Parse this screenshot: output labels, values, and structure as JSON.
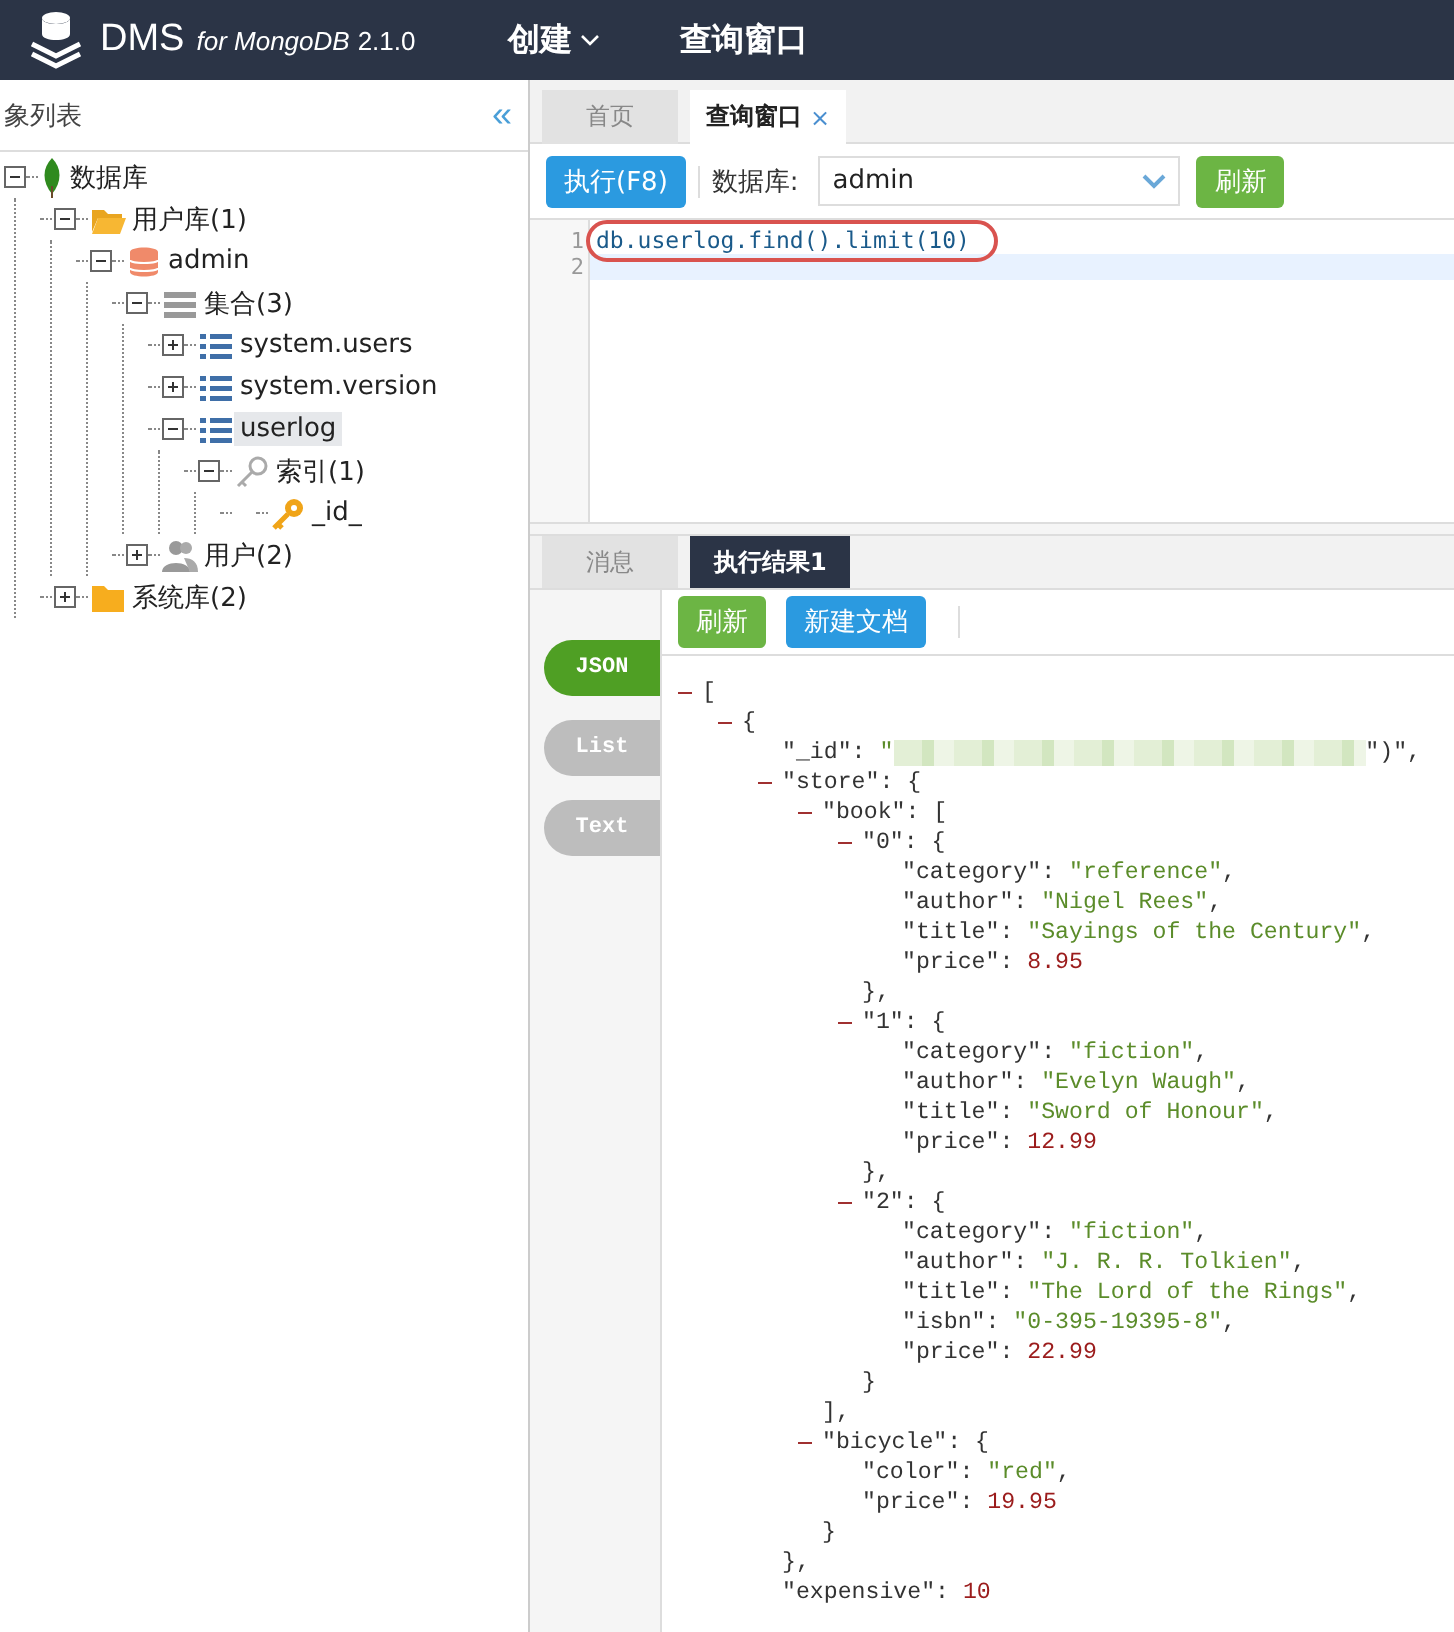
{
  "header": {
    "brand": "DMS",
    "brand_suffix": "for MongoDB",
    "version": "2.1.0",
    "nav": [
      {
        "label": "创建",
        "dropdown": true
      },
      {
        "label": "查询窗口",
        "dropdown": false
      }
    ]
  },
  "sidebar": {
    "title": "象列表",
    "collapse": "«",
    "tree": [
      {
        "label": "数据库",
        "kind": "leaf",
        "expanded": true,
        "selected": false,
        "children": [
          {
            "label": "用户库(1)",
            "kind": "folder-open",
            "expanded": true,
            "selected": false,
            "children": [
              {
                "label": "admin",
                "kind": "database",
                "expanded": true,
                "selected": false,
                "children": [
                  {
                    "label": "集合(3)",
                    "kind": "stack",
                    "expanded": true,
                    "selected": false,
                    "children": [
                      {
                        "label": "system.users",
                        "kind": "list",
                        "expanded": false,
                        "selected": false
                      },
                      {
                        "label": "system.version",
                        "kind": "list",
                        "expanded": false,
                        "selected": false
                      },
                      {
                        "label": "userlog",
                        "kind": "list",
                        "expanded": true,
                        "selected": true,
                        "children": [
                          {
                            "label": "索引(1)",
                            "kind": "key-outline",
                            "expanded": true,
                            "selected": false,
                            "children": [
                              {
                                "label": "_id_",
                                "kind": "key",
                                "selected": false
                              }
                            ]
                          }
                        ]
                      }
                    ]
                  },
                  {
                    "label": "用户(2)",
                    "kind": "users",
                    "expanded": false,
                    "selected": false
                  }
                ]
              }
            ]
          },
          {
            "label": "系统库(2)",
            "kind": "folder",
            "expanded": false,
            "selected": false
          }
        ]
      }
    ]
  },
  "tabs": [
    {
      "label": "首页",
      "selected": false,
      "closable": false
    },
    {
      "label": "查询窗口",
      "selected": true,
      "closable": true,
      "close": "×"
    }
  ],
  "toolbar": {
    "run": "执行(F8)",
    "db_label": "数据库:",
    "db_value": "admin",
    "refresh": "刷新"
  },
  "editor": {
    "lines": [
      {
        "number": "1",
        "code": "db.userlog.find().limit(10)",
        "current": false,
        "annotated": true
      },
      {
        "number": "2",
        "current": true
      }
    ]
  },
  "result_tabs": [
    {
      "label": "消息",
      "selected": false
    },
    {
      "label": "执行结果1",
      "selected": true
    }
  ],
  "view_modes": [
    {
      "label": "JSON",
      "selected": true
    },
    {
      "label": "List",
      "selected": false
    },
    {
      "label": "Text",
      "selected": false
    }
  ],
  "result_toolbar": {
    "buttons": [
      {
        "label": "刷新",
        "kind": "green"
      },
      {
        "label": "新建文档",
        "kind": "blue"
      }
    ]
  },
  "result": {
    "kind": "node",
    "label": "[",
    "expanded": true,
    "children": [
      {
        "kind": "node",
        "label": "{",
        "expanded": true,
        "children": [
          {
            "kind": "redacted",
            "key": "\"_id\": ",
            "prefix": "\"",
            "suffix": "\")\","
          },
          {
            "kind": "node",
            "label": "\"store\": {",
            "expanded": true,
            "close": "},",
            "children": [
              {
                "kind": "node",
                "label": "\"book\": [",
                "expanded": true,
                "close": "],",
                "children": [
                  {
                    "kind": "node",
                    "label": "\"0\": {",
                    "expanded": true,
                    "close": "},",
                    "children": [
                      {
                        "kind": "string",
                        "key": "\"category\": ",
                        "value": "\"reference\"",
                        "tail": ","
                      },
                      {
                        "kind": "string",
                        "key": "\"author\": ",
                        "value": "\"Nigel Rees\"",
                        "tail": ","
                      },
                      {
                        "kind": "string",
                        "key": "\"title\": ",
                        "value": "\"Sayings of the Century\"",
                        "tail": ","
                      },
                      {
                        "kind": "number",
                        "key": "\"price\": ",
                        "value": "8.95"
                      }
                    ]
                  },
                  {
                    "kind": "node",
                    "label": "\"1\": {",
                    "expanded": true,
                    "close": "},",
                    "children": [
                      {
                        "kind": "string",
                        "key": "\"category\": ",
                        "value": "\"fiction\"",
                        "tail": ","
                      },
                      {
                        "kind": "string",
                        "key": "\"author\": ",
                        "value": "\"Evelyn Waugh\"",
                        "tail": ","
                      },
                      {
                        "kind": "string",
                        "key": "\"title\": ",
                        "value": "\"Sword of Honour\"",
                        "tail": ","
                      },
                      {
                        "kind": "number",
                        "key": "\"price\": ",
                        "value": "12.99"
                      }
                    ]
                  },
                  {
                    "kind": "node",
                    "label": "\"2\": {",
                    "expanded": true,
                    "close": "}",
                    "children": [
                      {
                        "kind": "string",
                        "key": "\"category\": ",
                        "value": "\"fiction\"",
                        "tail": ","
                      },
                      {
                        "kind": "string",
                        "key": "\"author\": ",
                        "value": "\"J. R. R. Tolkien\"",
                        "tail": ","
                      },
                      {
                        "kind": "string",
                        "key": "\"title\": ",
                        "value": "\"The Lord of the Rings\"",
                        "tail": ","
                      },
                      {
                        "kind": "string",
                        "key": "\"isbn\": ",
                        "value": "\"0-395-19395-8\"",
                        "tail": ","
                      },
                      {
                        "kind": "number",
                        "key": "\"price\": ",
                        "value": "22.99"
                      }
                    ]
                  }
                ]
              },
              {
                "kind": "node",
                "label": "\"bicycle\": {",
                "expanded": true,
                "close": "}",
                "children": [
                  {
                    "kind": "string",
                    "key": "\"color\": ",
                    "value": "\"red\"",
                    "tail": ","
                  },
                  {
                    "kind": "number",
                    "key": "\"price\": ",
                    "value": "19.95"
                  }
                ]
              }
            ]
          },
          {
            "kind": "number",
            "key": "\"expensive\": ",
            "value": "10"
          }
        ]
      }
    ]
  }
}
